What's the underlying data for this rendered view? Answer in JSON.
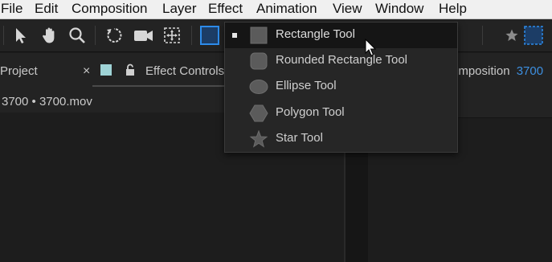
{
  "menubar": {
    "items": [
      "File",
      "Edit",
      "Composition",
      "Layer",
      "Effect",
      "Animation",
      "View",
      "Window",
      "Help"
    ]
  },
  "panels": {
    "project_tab": "Project",
    "close_symbol": "×",
    "effect_controls_tab": "Effect Controls",
    "source_label": "3700 • 3700.mov",
    "composition_tab": "omposition",
    "composition_name": "3700"
  },
  "dropdown": {
    "items": [
      {
        "label": "Rectangle Tool",
        "icon": "rectangle-icon",
        "selected": true
      },
      {
        "label": "Rounded Rectangle Tool",
        "icon": "rounded-rectangle-icon",
        "selected": false
      },
      {
        "label": "Ellipse Tool",
        "icon": "ellipse-icon",
        "selected": false
      },
      {
        "label": "Polygon Tool",
        "icon": "polygon-icon",
        "selected": false
      },
      {
        "label": "Star Tool",
        "icon": "star-icon",
        "selected": false
      }
    ]
  },
  "colors": {
    "accent_blue": "#2d8ceb",
    "swatch_teal": "#9fd3d6",
    "composition_name": "#3d8fe0"
  }
}
